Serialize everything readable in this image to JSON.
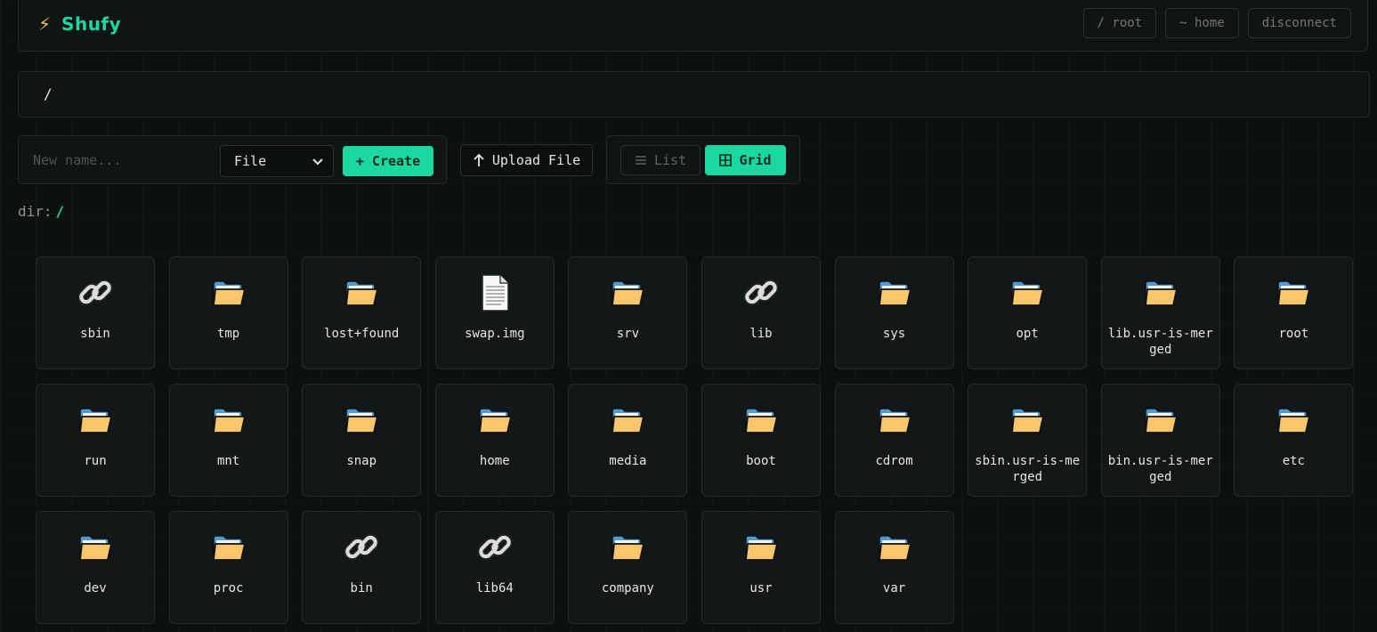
{
  "app": {
    "title": "Shufy",
    "logo_icon": "lightning-bolt-icon",
    "accent": "#19d9a0"
  },
  "nav": {
    "root_label": "/ root",
    "home_label": "~ home",
    "disconnect_label": "disconnect"
  },
  "path": {
    "current": "/"
  },
  "create": {
    "name_placeholder": "New name...",
    "type_value": "File",
    "create_label": "+ Create"
  },
  "upload": {
    "label": "Upload File"
  },
  "view": {
    "list_label": "List",
    "grid_label": "Grid",
    "active": "Grid"
  },
  "dir": {
    "prefix": "dir:",
    "path": "/"
  },
  "entries": [
    {
      "name": "sbin",
      "type": "link"
    },
    {
      "name": "tmp",
      "type": "folder"
    },
    {
      "name": "lost+found",
      "type": "folder"
    },
    {
      "name": "swap.img",
      "type": "file"
    },
    {
      "name": "srv",
      "type": "folder"
    },
    {
      "name": "lib",
      "type": "link"
    },
    {
      "name": "sys",
      "type": "folder"
    },
    {
      "name": "opt",
      "type": "folder"
    },
    {
      "name": "lib.usr-is-merged",
      "type": "folder"
    },
    {
      "name": "root",
      "type": "folder"
    },
    {
      "name": "run",
      "type": "folder"
    },
    {
      "name": "mnt",
      "type": "folder"
    },
    {
      "name": "snap",
      "type": "folder"
    },
    {
      "name": "home",
      "type": "folder"
    },
    {
      "name": "media",
      "type": "folder"
    },
    {
      "name": "boot",
      "type": "folder"
    },
    {
      "name": "cdrom",
      "type": "folder"
    },
    {
      "name": "sbin.usr-is-merged",
      "type": "folder"
    },
    {
      "name": "bin.usr-is-merged",
      "type": "folder"
    },
    {
      "name": "etc",
      "type": "folder"
    },
    {
      "name": "dev",
      "type": "folder"
    },
    {
      "name": "proc",
      "type": "folder"
    },
    {
      "name": "bin",
      "type": "link"
    },
    {
      "name": "lib64",
      "type": "link"
    },
    {
      "name": "company",
      "type": "folder"
    },
    {
      "name": "usr",
      "type": "folder"
    },
    {
      "name": "var",
      "type": "folder"
    }
  ]
}
